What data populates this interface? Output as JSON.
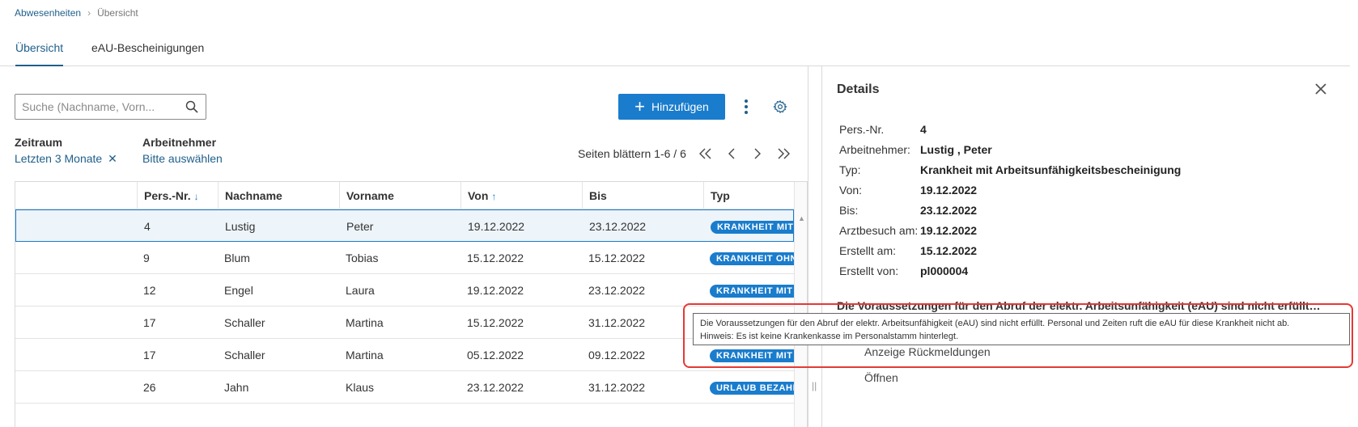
{
  "breadcrumb": {
    "parent": "Abwesenheiten",
    "current": "Übersicht"
  },
  "tabs": [
    {
      "label": "Übersicht"
    },
    {
      "label": "eAU-Bescheinigungen"
    }
  ],
  "search": {
    "placeholder": "Suche (Nachname, Vorn..."
  },
  "toolbar": {
    "add_label": "Hinzufügen"
  },
  "filters": {
    "zeitraum": {
      "label": "Zeitraum",
      "value": "Letzten 3 Monate"
    },
    "arbeitnehmer": {
      "label": "Arbeitnehmer",
      "value": "Bitte auswählen"
    }
  },
  "paging": {
    "label": "Seiten blättern 1-6 / 6"
  },
  "table": {
    "headers": {
      "persnr": "Pers.-Nr.",
      "nachname": "Nachname",
      "vorname": "Vorname",
      "von": "Von",
      "bis": "Bis",
      "typ": "Typ"
    },
    "rows": [
      {
        "persnr": "4",
        "nachname": "Lustig",
        "vorname": "Peter",
        "von": "19.12.2022",
        "bis": "23.12.2022",
        "typ": "KRANKHEIT MIT A"
      },
      {
        "persnr": "9",
        "nachname": "Blum",
        "vorname": "Tobias",
        "von": "15.12.2022",
        "bis": "15.12.2022",
        "typ": "KRANKHEIT OHN"
      },
      {
        "persnr": "12",
        "nachname": "Engel",
        "vorname": "Laura",
        "von": "19.12.2022",
        "bis": "23.12.2022",
        "typ": "KRANKHEIT MIT A"
      },
      {
        "persnr": "17",
        "nachname": "Schaller",
        "vorname": "Martina",
        "von": "15.12.2022",
        "bis": "31.12.2022",
        "typ": ""
      },
      {
        "persnr": "17",
        "nachname": "Schaller",
        "vorname": "Martina",
        "von": "05.12.2022",
        "bis": "09.12.2022",
        "typ": "KRANKHEIT MIT A"
      },
      {
        "persnr": "26",
        "nachname": "Jahn",
        "vorname": "Klaus",
        "von": "23.12.2022",
        "bis": "31.12.2022",
        "typ": "URLAUB BEZAHLT"
      }
    ]
  },
  "details": {
    "title": "Details",
    "fields": [
      {
        "key": "Pers.-Nr.",
        "value": "4"
      },
      {
        "key": "Arbeitnehmer:",
        "value": "Lustig , Peter"
      },
      {
        "key": "Typ:",
        "value": "Krankheit mit Arbeitsunfähigkeitsbescheinigung"
      },
      {
        "key": "Von:",
        "value": "19.12.2022"
      },
      {
        "key": "Bis:",
        "value": "23.12.2022"
      },
      {
        "key": "Arztbesuch am:",
        "value": "19.12.2022"
      },
      {
        "key": "Erstellt am:",
        "value": "15.12.2022"
      },
      {
        "key": "Erstellt von:",
        "value": "pl000004"
      }
    ],
    "message": "Die Voraussetzungen für den Abruf der elektr. Arbeitsunfähigkeit (eAU) sind nicht erfüllt. Personal und Zeiten ruft die eAU für diese Krankheit nicht ab.",
    "actions": [
      {
        "label": "Anzeige Rückmeldungen"
      },
      {
        "label": "Öffnen"
      }
    ]
  },
  "tooltip": {
    "line1": "Die Voraussetzungen für den Abruf der elektr. Arbeitsunfähigkeit (eAU) sind nicht erfüllt. Personal und Zeiten ruft die eAU für diese Krankheit nicht ab.",
    "line2": "Hinweis: Es ist keine Krankenkasse im Personalstamm hinterlegt."
  },
  "colors": {
    "accent": "#1a7ccc",
    "link": "#1f5f8b",
    "highlight": "#e53935"
  }
}
